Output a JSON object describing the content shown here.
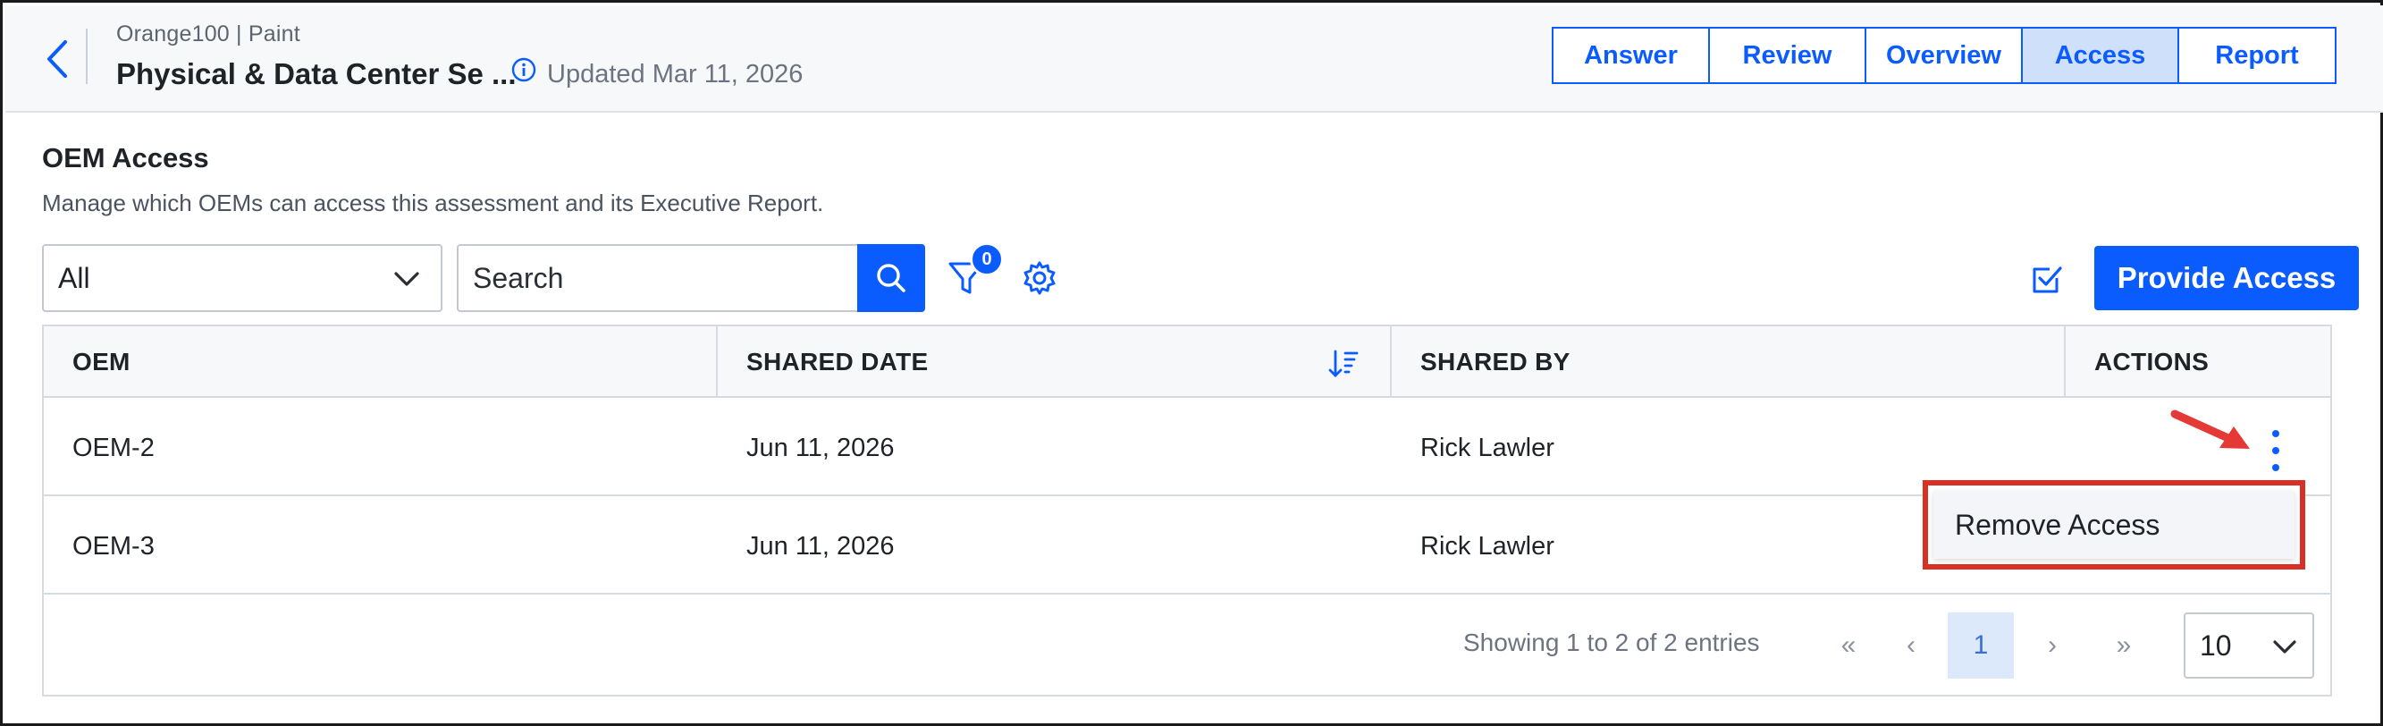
{
  "header": {
    "breadcrumb": "Orange100 | Paint",
    "title": "Physical & Data Center Se ...",
    "updated": "Updated Mar 11, 2026",
    "tabs": [
      {
        "label": "Answer",
        "active": false
      },
      {
        "label": "Review",
        "active": false
      },
      {
        "label": "Overview",
        "active": false
      },
      {
        "label": "Access",
        "active": true
      },
      {
        "label": "Report",
        "active": false
      }
    ]
  },
  "section": {
    "title": "OEM Access",
    "description": "Manage which OEMs can access this assessment and its Executive Report."
  },
  "toolbar": {
    "filter_select_value": "All",
    "search_placeholder": "Search",
    "filter_count": "0",
    "provide_access_label": "Provide Access"
  },
  "table": {
    "columns": [
      "OEM",
      "SHARED DATE",
      "SHARED BY",
      "ACTIONS"
    ],
    "rows": [
      {
        "oem": "OEM-2",
        "shared_date": "Jun 11, 2026",
        "shared_by": "Rick Lawler"
      },
      {
        "oem": "OEM-3",
        "shared_date": "Jun 11, 2026",
        "shared_by": "Rick Lawler"
      }
    ]
  },
  "action_menu": {
    "items": [
      "Remove Access"
    ]
  },
  "pagination": {
    "summary": "Showing 1 to 2 of 2 entries",
    "current_page": "1",
    "first": "«",
    "prev": "‹",
    "next": "›",
    "last": "»",
    "page_size": "10"
  },
  "colors": {
    "accent": "#0b5cff",
    "active_tab_bg": "#cfe0fb",
    "highlight_border": "#d93025",
    "annotation_arrow": "#e53935"
  }
}
